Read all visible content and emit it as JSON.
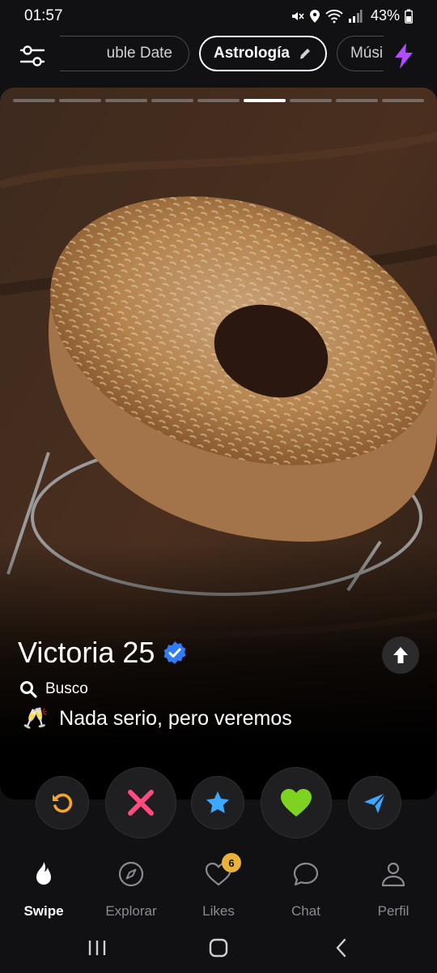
{
  "status_bar": {
    "time": "01:57",
    "battery": "43%"
  },
  "filters": {
    "chips": [
      {
        "label": "Double Date",
        "visible_text": "uble Date"
      },
      {
        "label": "Astrología"
      },
      {
        "label": "Música"
      }
    ],
    "active_chip": "Astrología"
  },
  "card": {
    "photo_count": 9,
    "active_photo_index": 5,
    "name": "Victoria",
    "age": "25",
    "verified": true,
    "looking_label": "Busco",
    "intent_emoji": "🥂",
    "intent_text": "Nada serio, pero veremos"
  },
  "actions": {
    "icons": [
      "rewind-icon",
      "nope-icon",
      "superlike-icon",
      "like-icon",
      "send-icon"
    ]
  },
  "nav": {
    "items": [
      {
        "label": "Swipe",
        "icon": "flame-icon",
        "active": true
      },
      {
        "label": "Explorar",
        "icon": "compass-icon",
        "active": false
      },
      {
        "label": "Likes",
        "icon": "heart-icon",
        "active": false,
        "badge": "6"
      },
      {
        "label": "Chat",
        "icon": "chat-icon",
        "active": false
      },
      {
        "label": "Perfil",
        "icon": "person-icon",
        "active": false
      }
    ]
  },
  "colors": {
    "nope": "#ff4b7d",
    "like": "#7ed321",
    "superlike": "#3ba9ff",
    "rewind": "#f5a623",
    "boost": "#b44dff",
    "badge": "#e8b23a",
    "verified": "#2f7cf6"
  }
}
